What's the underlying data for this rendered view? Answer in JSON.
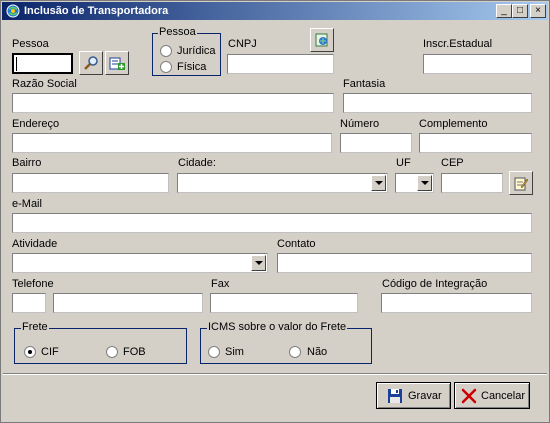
{
  "window": {
    "title": "Inclusão de Transportadora",
    "icon": "app-globe-icon",
    "controls": {
      "minimize": "_",
      "maximize": "□",
      "close": "×"
    }
  },
  "form": {
    "pessoa": {
      "label": "Pessoa",
      "value": ""
    },
    "tipo_pessoa": {
      "legend": "Pessoa",
      "options": [
        "Jurídica",
        "Física"
      ],
      "selected": null
    },
    "cnpj": {
      "label": "CNPJ",
      "value": ""
    },
    "inscr_estadual": {
      "label": "Inscr.Estadual",
      "value": ""
    },
    "razao_social": {
      "label": "Razão Social",
      "value": ""
    },
    "fantasia": {
      "label": "Fantasia",
      "value": ""
    },
    "endereco": {
      "label": "Endereço",
      "value": ""
    },
    "numero": {
      "label": "Número",
      "value": ""
    },
    "complemento": {
      "label": "Complemento",
      "value": ""
    },
    "bairro": {
      "label": "Bairro",
      "value": ""
    },
    "cidade": {
      "label": "Cidade:",
      "value": ""
    },
    "uf": {
      "label": "UF",
      "value": ""
    },
    "cep": {
      "label": "CEP",
      "value": ""
    },
    "email": {
      "label": "e-Mail",
      "value": ""
    },
    "atividade": {
      "label": "Atividade",
      "value": ""
    },
    "contato": {
      "label": "Contato",
      "value": ""
    },
    "telefone": {
      "label": "Telefone",
      "ddd": "",
      "value": ""
    },
    "fax": {
      "label": "Fax",
      "value": ""
    },
    "codigo_integracao": {
      "label": "Código de Integração",
      "value": ""
    }
  },
  "frete": {
    "legend": "Frete",
    "options": [
      "CIF",
      "FOB"
    ],
    "selected": "CIF"
  },
  "icms": {
    "legend": "ICMS sobre o valor do Frete",
    "options": [
      "Sim",
      "Não"
    ],
    "selected": null
  },
  "buttons": {
    "save": "Gravar",
    "cancel": "Cancelar"
  },
  "colors": {
    "titlebar_start": "#0a246a",
    "titlebar_end": "#a6caf0",
    "window_bg": "#d4d0c8",
    "group_border": "#0a246a",
    "cancel_icon": "#cc0000",
    "save_icon": "#1c3f9a"
  }
}
